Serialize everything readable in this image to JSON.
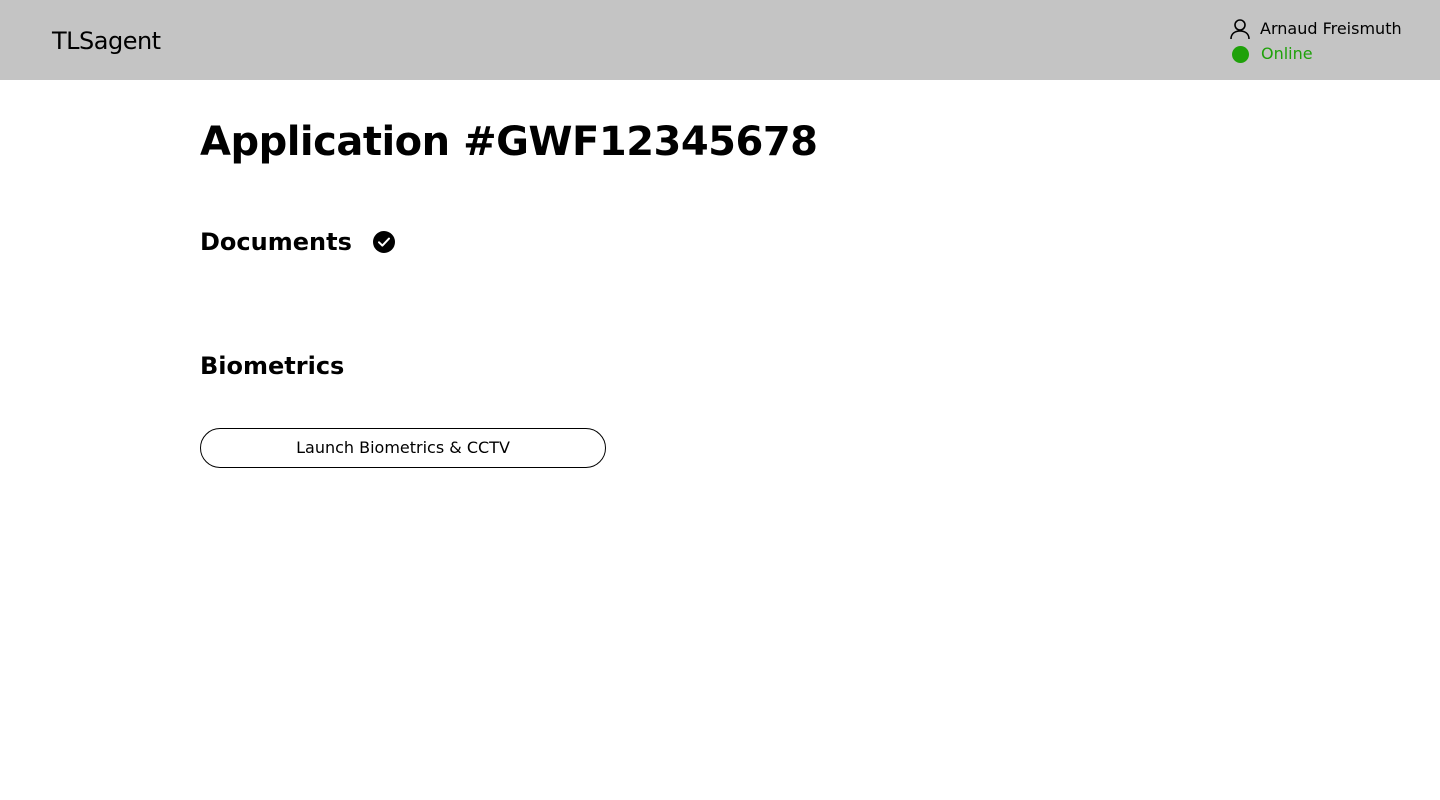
{
  "header": {
    "logo": "TLSagent",
    "user": {
      "icon": "user-icon",
      "name": "Arnaud Freismuth"
    },
    "status": {
      "label": "Online",
      "color": "#1fa10a"
    },
    "background": "#c4c4c4"
  },
  "main": {
    "title": "Application #GWF12345678",
    "sections": {
      "documents": {
        "title": "Documents",
        "status_icon": "check-circle-icon"
      },
      "biometrics": {
        "title": "Biometrics",
        "launch_button": "Launch Biometrics & CCTV"
      }
    }
  }
}
